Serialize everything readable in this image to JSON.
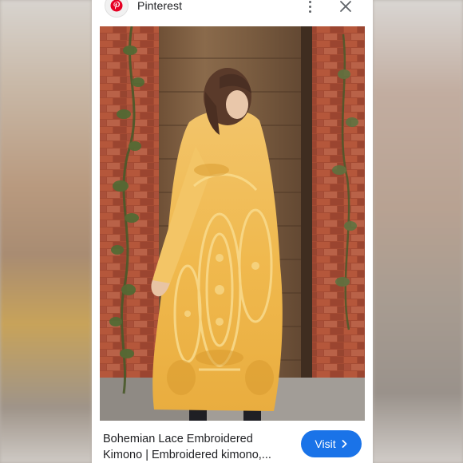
{
  "header": {
    "site_name": "Pinterest",
    "site_icon": "pinterest-icon",
    "menu_icon": "more-vert-icon",
    "close_icon": "close-icon"
  },
  "image": {
    "alt": "Woman wearing yellow bohemian lace embroidered kimono in front of wooden door and brick wall"
  },
  "footer": {
    "caption_line1": "Bohemian Lace Embroidered",
    "caption_line2": "Kimono | Embroidered kimono,...",
    "visit_label": "Visit",
    "visit_icon": "chevron-right-icon"
  },
  "colors": {
    "brand_red": "#e60023",
    "visit_blue": "#1a73e8"
  }
}
